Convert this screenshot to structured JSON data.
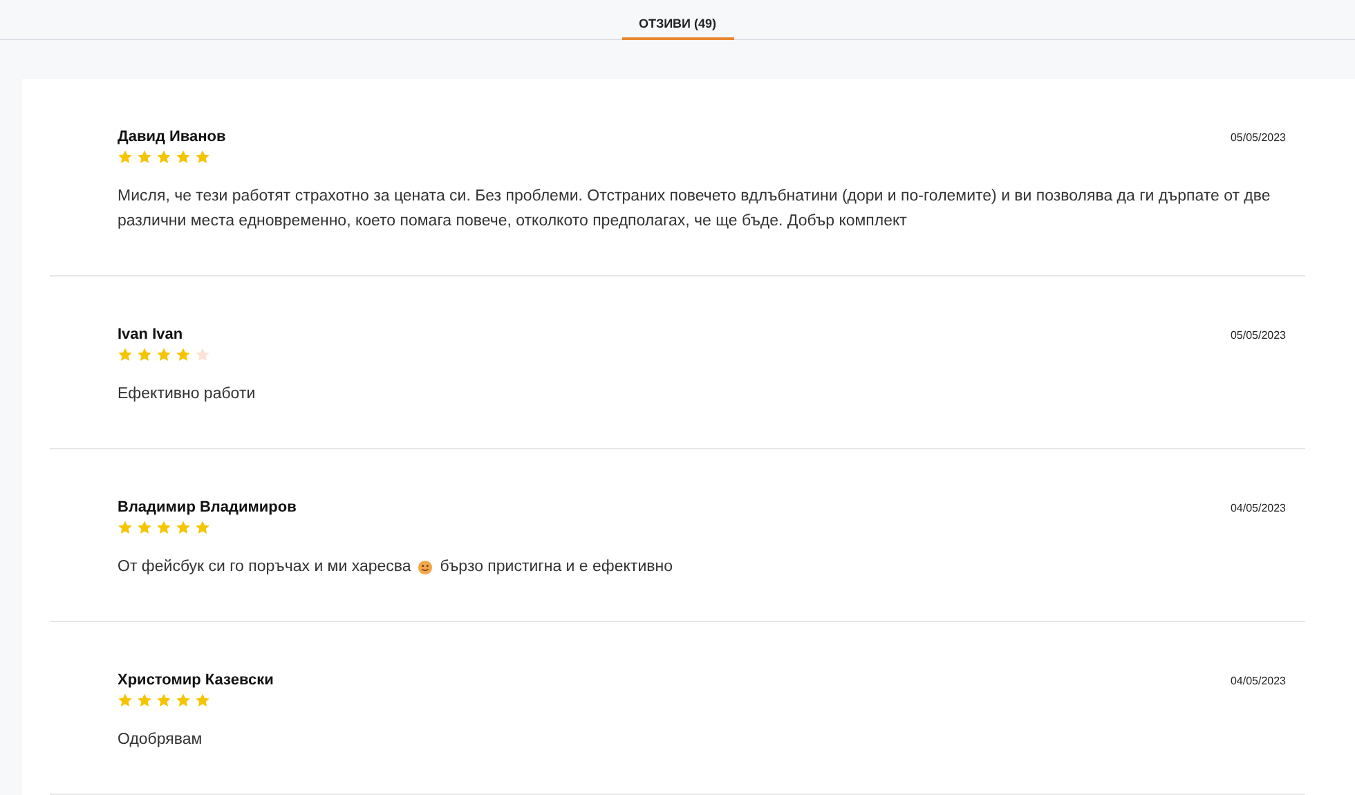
{
  "tabs": [
    {
      "label": "ОТЗИВИ (49)",
      "selected": true
    }
  ],
  "reviews": [
    {
      "author": "Давид Иванов",
      "date": "05/05/2023",
      "stars": 5,
      "body": [
        {
          "kind": "text",
          "text": "Мисля, че тези работят страхотно за цената си. Без проблеми. Отстраних повечето вдлъбнатини (дори и по-големите) и ви позволява да ги дърпате от две различни места едновременно, което помага повече, отколкото предполагах, че ще бъде. Добър комплект"
        }
      ]
    },
    {
      "author": "Ivan Ivan",
      "date": "05/05/2023",
      "stars": 4,
      "body": [
        {
          "kind": "text",
          "text": "Ефективно работи"
        }
      ]
    },
    {
      "author": "Владимир Владимиров",
      "date": "04/05/2023",
      "stars": 5,
      "body": [
        {
          "kind": "text",
          "text": "От фейсбук си го поръчах и ми харесва"
        },
        {
          "kind": "emoji"
        },
        {
          "kind": "text",
          "text": "бързо пристигна и е ефективно"
        }
      ]
    },
    {
      "author": "Христомир Казевски",
      "date": "04/05/2023",
      "stars": 5,
      "body": [
        {
          "kind": "text",
          "text": "Одобрявам"
        }
      ]
    }
  ]
}
